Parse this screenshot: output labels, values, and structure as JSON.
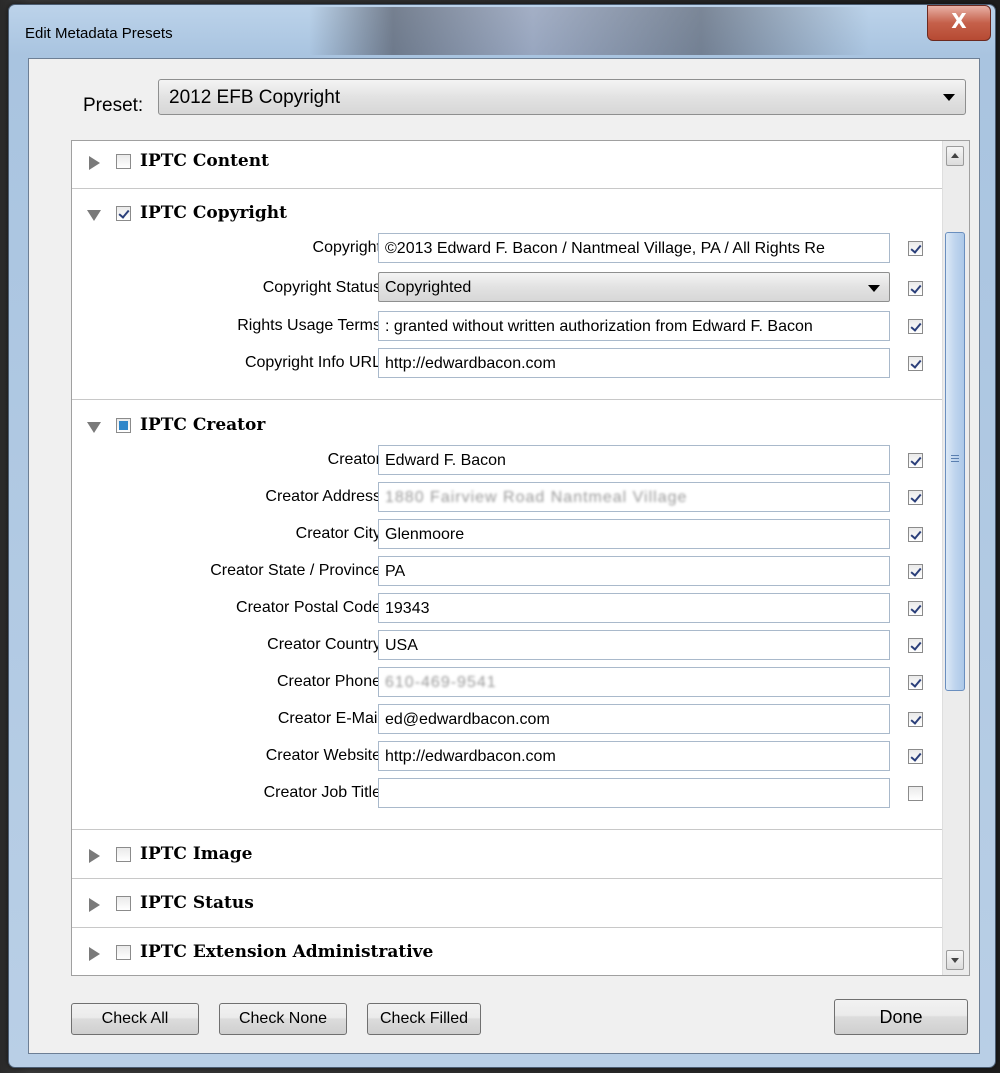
{
  "window": {
    "title": "Edit Metadata Presets",
    "close_label": "X"
  },
  "preset": {
    "label": "Preset:",
    "value": "2012 EFB Copyright"
  },
  "sections": {
    "content": {
      "title": "IPTC Content",
      "checked": false
    },
    "copyright": {
      "title": "IPTC Copyright",
      "checked": true,
      "fields": {
        "copyright": {
          "label": "Copyright",
          "value": "©2013  Edward F. Bacon / Nantmeal Village, PA / All Rights Re",
          "checked": true
        },
        "status": {
          "label": "Copyright Status",
          "value": "Copyrighted",
          "checked": true
        },
        "rights": {
          "label": "Rights Usage Terms",
          "value": ": granted without written authorization from Edward F. Bacon",
          "checked": true
        },
        "url": {
          "label": "Copyright Info URL",
          "value": "http://edwardbacon.com",
          "checked": true
        }
      }
    },
    "creator": {
      "title": "IPTC Creator",
      "checked": "partial",
      "fields": {
        "creator": {
          "label": "Creator",
          "value": "Edward F. Bacon",
          "checked": true
        },
        "address": {
          "label": "Creator Address",
          "value": "1880 Fairview Road Nantmeal Village",
          "checked": true
        },
        "city": {
          "label": "Creator City",
          "value": "Glenmoore",
          "checked": true
        },
        "state": {
          "label": "Creator State / Province",
          "value": "PA",
          "checked": true
        },
        "postal": {
          "label": "Creator Postal Code",
          "value": "19343",
          "checked": true
        },
        "country": {
          "label": "Creator Country",
          "value": "USA",
          "checked": true
        },
        "phone": {
          "label": "Creator Phone",
          "value": "610-469-9541",
          "checked": true
        },
        "email": {
          "label": "Creator E-Mail",
          "value": "ed@edwardbacon.com",
          "checked": true
        },
        "website": {
          "label": "Creator Website",
          "value": "http://edwardbacon.com",
          "checked": true
        },
        "job": {
          "label": "Creator Job Title",
          "value": "",
          "checked": false
        }
      }
    },
    "image": {
      "title": "IPTC Image",
      "checked": false
    },
    "status": {
      "title": "IPTC Status",
      "checked": false
    },
    "extension": {
      "title": "IPTC Extension Administrative",
      "checked": false
    }
  },
  "buttons": {
    "check_all": "Check All",
    "check_none": "Check None",
    "check_filled": "Check Filled",
    "done": "Done"
  }
}
